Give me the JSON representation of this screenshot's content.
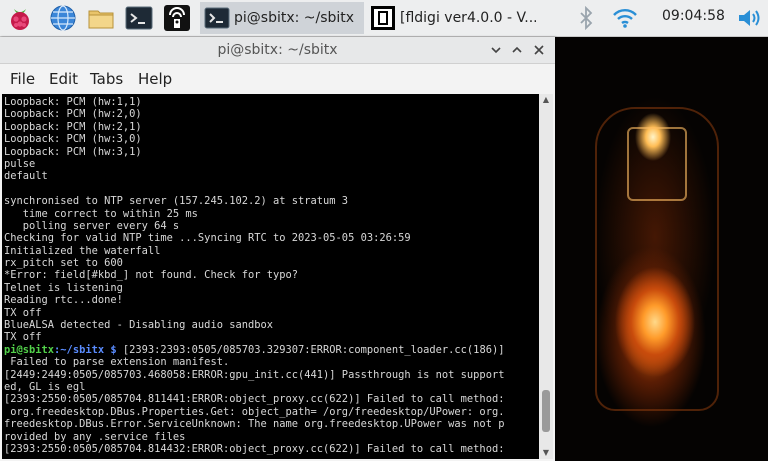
{
  "taskbar": {
    "tasks": [
      {
        "label": "pi@sbitx: ~/sbitx",
        "active": true
      },
      {
        "label": "[fldigi ver4.0.0 - V...",
        "active": false
      }
    ],
    "clock": "09:04:58",
    "launchers": [
      "raspberry-menu-icon",
      "web-browser-icon",
      "file-manager-icon",
      "terminal-icon",
      "radio-app-icon"
    ],
    "tray": [
      "bluetooth-icon",
      "wifi-icon",
      "volume-icon"
    ]
  },
  "window": {
    "title": "pi@sbitx: ~/sbitx",
    "buttons": [
      "minimize",
      "maximize",
      "close"
    ],
    "menu": [
      "File",
      "Edit",
      "Tabs",
      "Help"
    ]
  },
  "terminal": {
    "prompt_user": "pi@sbitx",
    "prompt_path": ":~/sbitx $",
    "lines_before": [
      "Loopback: PCM (hw:1,1)",
      "Loopback: PCM (hw:2,0)",
      "Loopback: PCM (hw:2,1)",
      "Loopback: PCM (hw:3,0)",
      "Loopback: PCM (hw:3,1)",
      "pulse",
      "default",
      "",
      "synchronised to NTP server (157.245.102.2) at stratum 3",
      "   time correct to within 25 ms",
      "   polling server every 64 s",
      "Checking for valid NTP time ...Syncing RTC to 2023-05-05 03:26:59",
      "Initialized the waterfall",
      "rx_pitch set to 600",
      "*Error: field[#kbd_] not found. Check for typo?",
      "Telnet is listening",
      "Reading rtc...done!",
      "TX off",
      "BlueALSA detected - Disabling audio sandbox",
      "TX off"
    ],
    "prompt_rest": " [2393:2393:0505/085703.329307:ERROR:component_loader.cc(186)]",
    "lines_after": [
      " Failed to parse extension manifest.",
      "[2449:2449:0505/085703.468058:ERROR:gpu_init.cc(441)] Passthrough is not support",
      "ed, GL is egl",
      "[2393:2550:0505/085704.811441:ERROR:object_proxy.cc(622)] Failed to call method:",
      " org.freedesktop.DBus.Properties.Get: object_path= /org/freedesktop/UPower: org.",
      "freedesktop.DBus.Error.ServiceUnknown: The name org.freedesktop.UPower was not p",
      "rovided by any .service files",
      "[2393:2550:0505/085704.814432:ERROR:object_proxy.cc(622)] Failed to call method:"
    ]
  },
  "colors": {
    "prompt_user": "#52d24a",
    "prompt_path": "#5a8cff",
    "terminal_bg": "#000000",
    "terminal_fg": "#d8d8d8"
  }
}
